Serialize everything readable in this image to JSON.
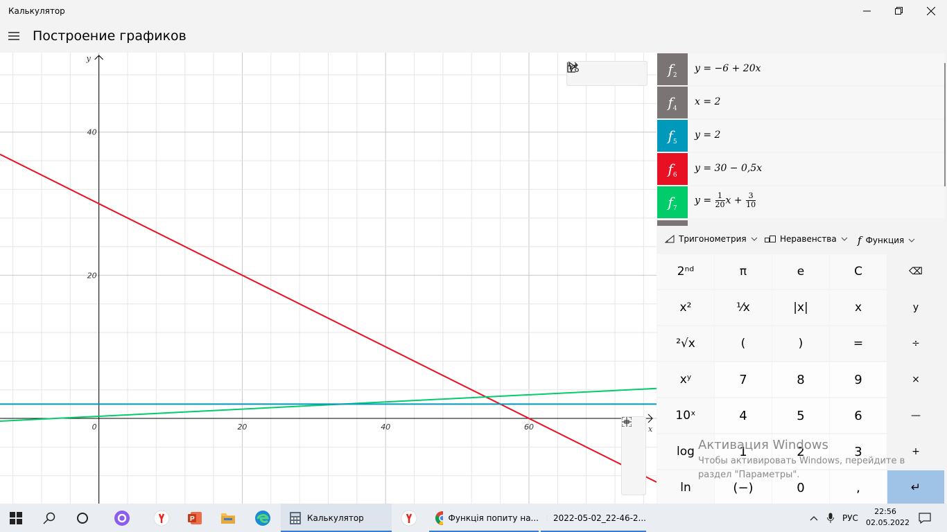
{
  "window": {
    "title": "Калькулятор",
    "minimize_glyph": "—",
    "maximize_glyph": "❐",
    "close_glyph": "✕"
  },
  "header": {
    "title": "Построение графиков"
  },
  "graph": {
    "axis_x_label": "x",
    "axis_y_label": "y",
    "x_ticks": [
      "0",
      "20",
      "40",
      "60"
    ],
    "y_ticks": [
      "40",
      "20"
    ],
    "x_tick_values": [
      0,
      20,
      40,
      60
    ],
    "y_tick_values": [
      40,
      20
    ],
    "x_range": [
      -13.8,
      77.8
    ],
    "y_range": [
      -11.9,
      51.1
    ],
    "grid_step": 4,
    "colors": {
      "red": "#e81123",
      "green": "#00cc6a",
      "cyan": "#0099bc",
      "gray": "#7a7574",
      "axis": "#000000"
    },
    "lines": [
      {
        "equation": "y = 30 − 0,5x",
        "slope": -0.5,
        "intercept": 30,
        "color": "#e81123"
      },
      {
        "equation": "y = 1/20x + 3/10",
        "slope": 0.05,
        "intercept": 0.3,
        "color": "#00cc6a"
      },
      {
        "equation": "y = 2",
        "slope": 0,
        "intercept": 2,
        "color": "#0099bc"
      }
    ],
    "toolbar": {
      "select_icon": "cursor-icon",
      "share_icon": "share-icon",
      "settings_icon": "graph-settings-icon"
    },
    "zoom": {
      "in": "+",
      "out": "—",
      "fit": "fit-icon"
    }
  },
  "functions": [
    {
      "name": "f",
      "index": "2",
      "color": "#7a7574",
      "expr": "y = −6 + 20x"
    },
    {
      "name": "f",
      "index": "4",
      "color": "#7a7574",
      "expr": "x = 2"
    },
    {
      "name": "f",
      "index": "5",
      "color": "#0099bc",
      "expr": "y = 2"
    },
    {
      "name": "f",
      "index": "6",
      "color": "#e81123",
      "expr": "y = 30 − 0,5x"
    },
    {
      "name": "f",
      "index": "7",
      "color": "#00cc6a",
      "expr_prefix": "y = ",
      "frac1_num": "1",
      "frac1_den": "20",
      "expr_mid": "x + ",
      "frac2_num": "3",
      "frac2_den": "10"
    }
  ],
  "dropdowns": {
    "trig": "Тригонометрия",
    "ineq": "Неравенства",
    "func": "Функция",
    "func_glyph": "f"
  },
  "keypad": {
    "row1": [
      "2ⁿᵈ",
      "π",
      "e",
      "C",
      "⌫"
    ],
    "row2": [
      "x²",
      "¹⁄x",
      "|x|",
      "x",
      "y"
    ],
    "row3": [
      "²√x",
      "(",
      ")",
      "=",
      "÷"
    ],
    "row4": [
      "xʸ",
      "7",
      "8",
      "9",
      "×"
    ],
    "row5": [
      "10ˣ",
      "4",
      "5",
      "6",
      "—"
    ],
    "row6": [
      "log",
      "1",
      "2",
      "3",
      "+"
    ],
    "row7": [
      "ln",
      "(−)",
      "0",
      ",",
      "↵"
    ]
  },
  "watermark": {
    "title": "Активация Windows",
    "text": "Чтобы активировать Windows, перейдите в раздел \"Параметры\"."
  },
  "taskbar": {
    "apps": [
      {
        "label": "Калькулятор"
      },
      {
        "label": "Функція попиту на..."
      },
      {
        "label": "2022-05-02_22-46-2..."
      }
    ],
    "lang": "РУС",
    "time": "22:56",
    "date": "02.05.2022"
  }
}
